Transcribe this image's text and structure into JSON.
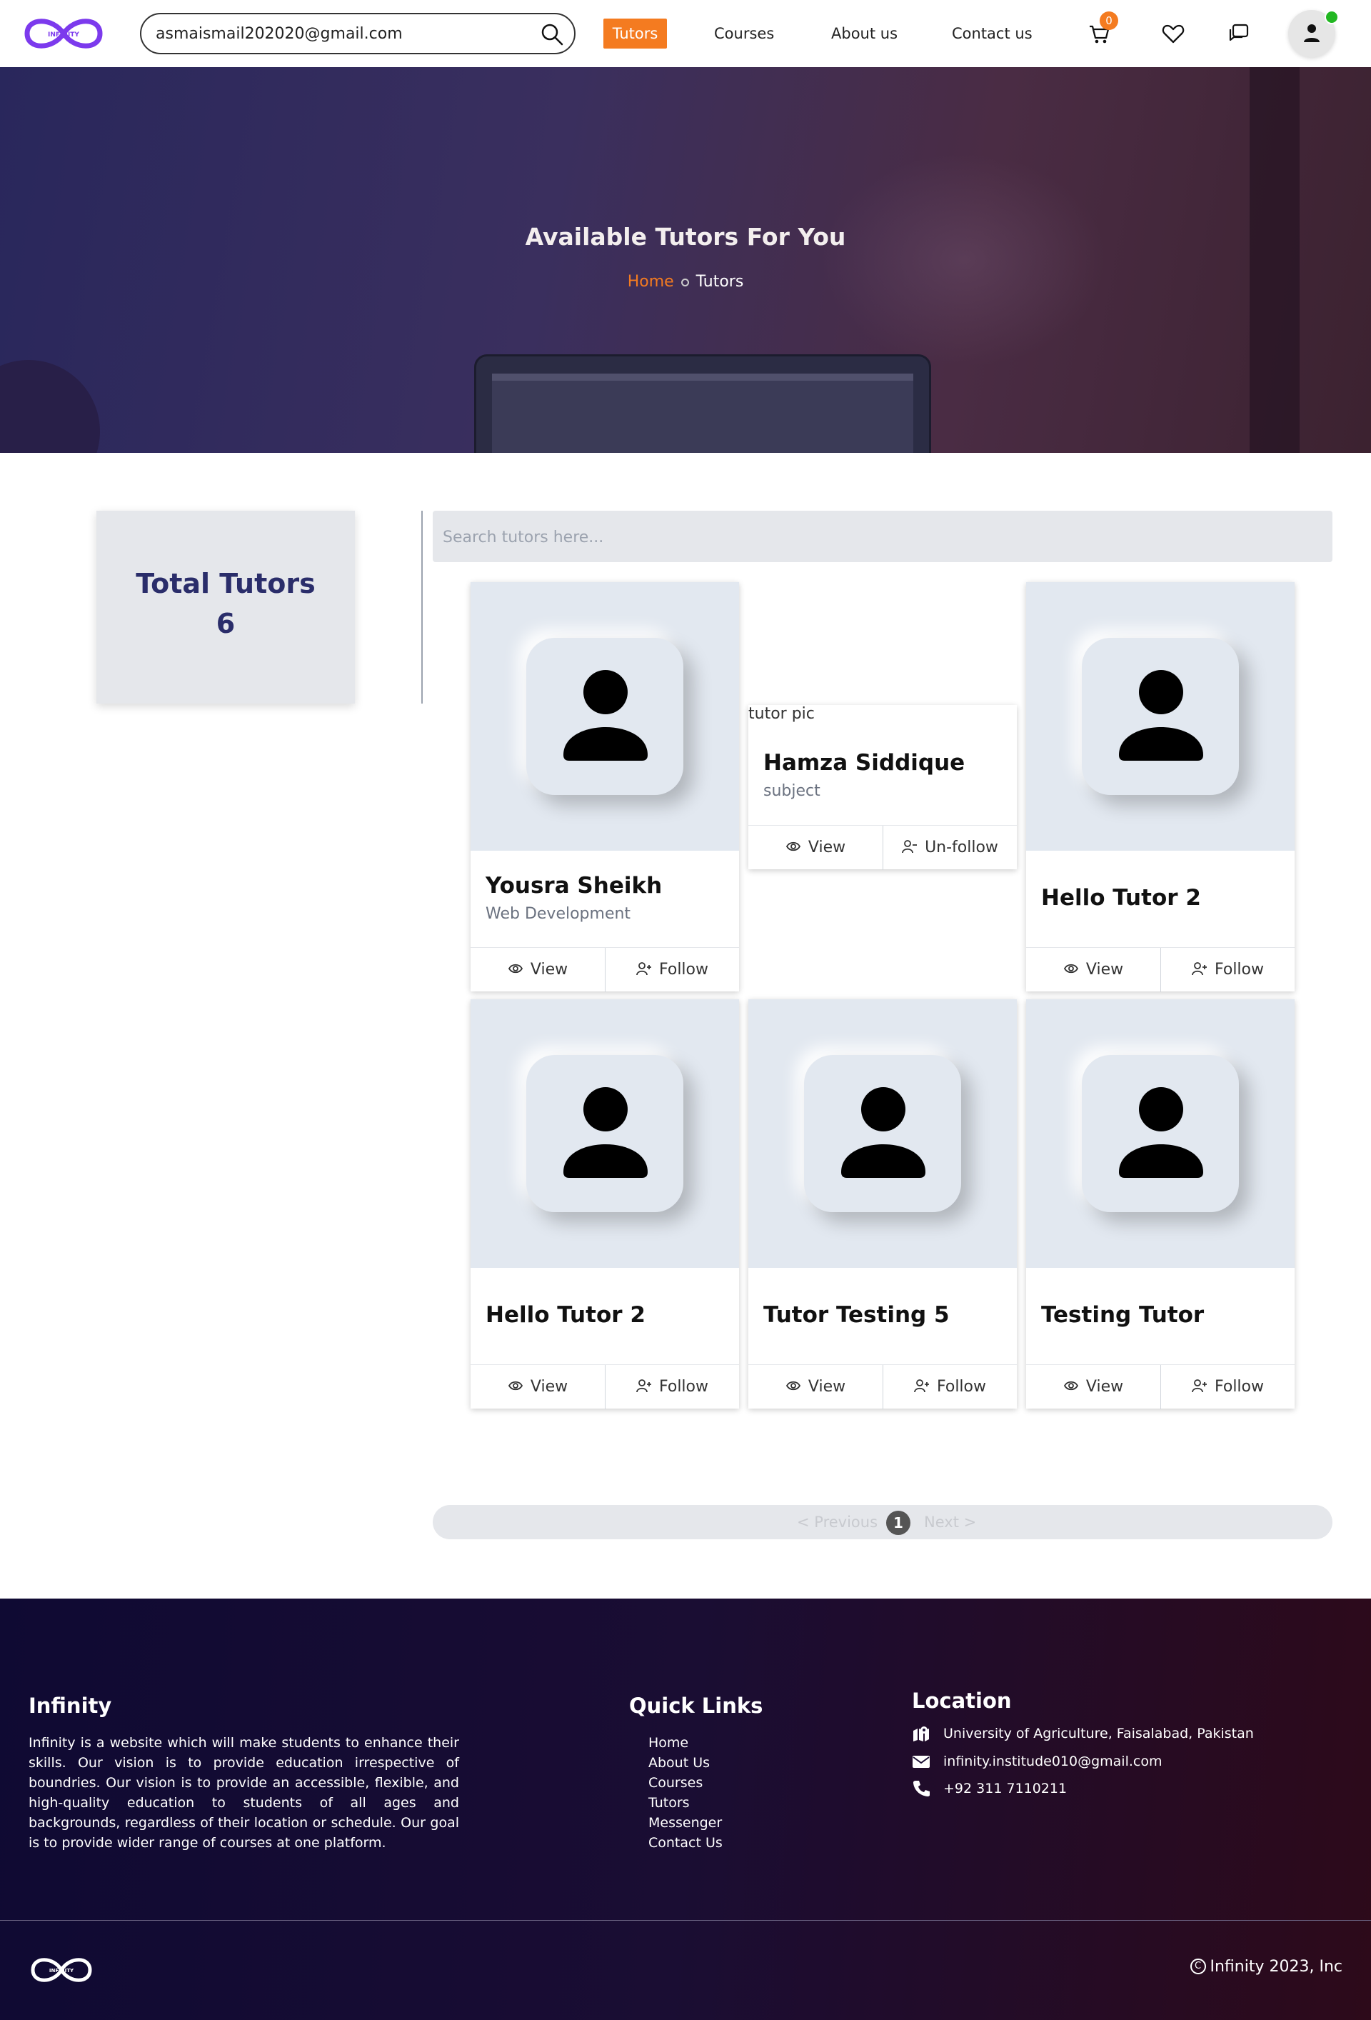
{
  "nav": {
    "logo_text": "INFINITY",
    "search_value": "asmaismail202020@gmail.com",
    "links": [
      "Tutors",
      "Courses",
      "About us",
      "Contact us"
    ],
    "active_link": "Tutors",
    "cart_count": "0",
    "icons": [
      "search-icon",
      "cart-icon",
      "heart-icon",
      "chat-icon",
      "user-icon"
    ],
    "online_color": "#22b722"
  },
  "hero": {
    "title": "Available Tutors For You",
    "breadcrumb": [
      "Home",
      "Tutors"
    ]
  },
  "sidebar": {
    "total_label": "Total Tutors",
    "total_value": "6"
  },
  "tutor_search": {
    "placeholder": "Search tutors here..."
  },
  "tutors": [
    {
      "name": "Yousra Sheikh",
      "subject": "Web Development",
      "view": "View",
      "action": "Follow"
    },
    {
      "name": "Hamza Siddique",
      "subject": "subject",
      "image_alt": "tutor pic",
      "view": "View",
      "action": "Un-follow"
    },
    {
      "name": "Hello Tutor 2",
      "subject": "",
      "view": "View",
      "action": "Follow"
    },
    {
      "name": "Hello Tutor 2",
      "subject": "",
      "view": "View",
      "action": "Follow"
    },
    {
      "name": "Tutor Testing 5",
      "subject": "",
      "view": "View",
      "action": "Follow"
    },
    {
      "name": "Testing Tutor",
      "subject": "",
      "view": "View",
      "action": "Follow"
    }
  ],
  "pagination": {
    "prev": "< Previous",
    "current": "1",
    "next": "Next >"
  },
  "footer": {
    "brand": "Infinity",
    "about": "Infinity is a website which will make students to enhance their skills. Our vision is to provide education irrespective of boundries. Our vision is to provide an accessible, flexible, and high-quality education to students of all ages and backgrounds, regardless of their location or schedule. Our goal is to provide wider range of courses at one platform.",
    "quick_links_title": "Quick Links",
    "quick_links": [
      "Home",
      "About Us",
      "Courses",
      "Tutors",
      "Messenger",
      "Contact Us"
    ],
    "location_title": "Location",
    "address": "University of Agriculture, Faisalabad, Pakistan",
    "email": "infinity.institude010@gmail.com",
    "phone": "+92 311 7110211",
    "copyright": "Infinity 2023, Inc",
    "copyright_symbol": "C"
  },
  "colors": {
    "accent": "#f47b20",
    "brand_logo": "#7c3aed",
    "heading": "#2a2d6a",
    "card_bg": "#e2e8f0"
  }
}
